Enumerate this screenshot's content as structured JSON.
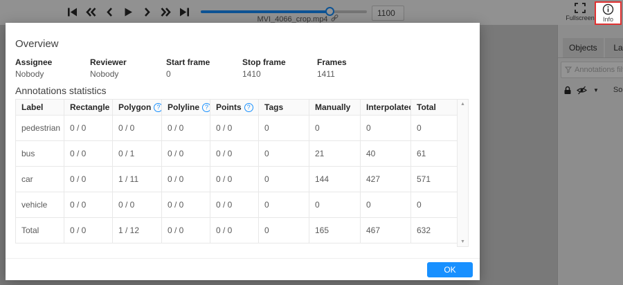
{
  "player": {
    "filename": "MVI_4066_crop.mp4",
    "frame_value": "1100",
    "slider_percent": 78,
    "controls": [
      "first-frame",
      "jump-backward",
      "previous-frame",
      "play",
      "next-frame",
      "jump-forward",
      "last-frame"
    ]
  },
  "topbar_right": {
    "fullscreen_label": "Fullscreen",
    "info_label": "Info"
  },
  "sidebar": {
    "tabs": [
      {
        "label": "Objects"
      },
      {
        "label": "Labels"
      }
    ],
    "filter_placeholder": "Annotations filter",
    "icon_row": [
      "lock-icon",
      "eye-hidden-icon",
      "caret-down-icon"
    ],
    "sort_label": "So"
  },
  "modal": {
    "title": "Overview",
    "meta": [
      {
        "label": "Assignee",
        "value": "Nobody"
      },
      {
        "label": "Reviewer",
        "value": "Nobody"
      },
      {
        "label": "Start frame",
        "value": "0"
      },
      {
        "label": "Stop frame",
        "value": "1410"
      },
      {
        "label": "Frames",
        "value": "1411"
      }
    ],
    "stats_title": "Annotations statistics",
    "table": {
      "columns": [
        "Label",
        "Rectangle",
        "Polygon",
        "Polyline",
        "Points",
        "Tags",
        "Manually",
        "Interpolated",
        "Total"
      ],
      "help_icon": "?",
      "rows": [
        {
          "label": "pedestrian",
          "cells": [
            "0 / 0",
            "0 / 0",
            "0 / 0",
            "0 / 0",
            "0",
            "0",
            "0",
            "0"
          ]
        },
        {
          "label": "bus",
          "cells": [
            "0 / 0",
            "0 / 1",
            "0 / 0",
            "0 / 0",
            "0",
            "21",
            "40",
            "61"
          ]
        },
        {
          "label": "car",
          "cells": [
            "0 / 0",
            "1 / 11",
            "0 / 0",
            "0 / 0",
            "0",
            "144",
            "427",
            "571"
          ]
        },
        {
          "label": "vehicle",
          "cells": [
            "0 / 0",
            "0 / 0",
            "0 / 0",
            "0 / 0",
            "0",
            "0",
            "0",
            "0"
          ]
        },
        {
          "label": "Total",
          "cells": [
            "0 / 0",
            "1 / 12",
            "0 / 0",
            "0 / 0",
            "0",
            "165",
            "467",
            "632"
          ]
        }
      ]
    },
    "ok_label": "OK"
  },
  "colors": {
    "accent": "#1890ff",
    "info_highlight_border": "#e03131"
  }
}
